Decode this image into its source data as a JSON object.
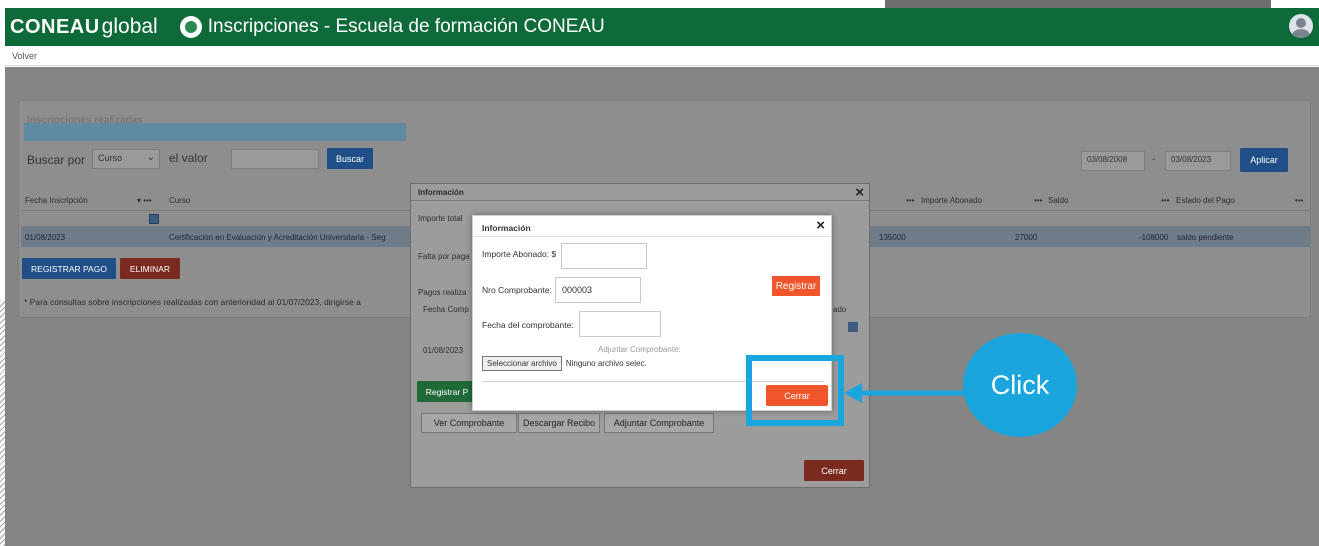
{
  "header": {
    "brand_bold": "CONEAU",
    "brand_light": "global",
    "app_title": "Inscripciones - Escuela de formación CONEAU",
    "icons": [
      "app-logo-icon",
      "user-avatar-icon"
    ]
  },
  "subbar": {
    "back_link": "Volver"
  },
  "panel": {
    "title": "Inscripciones realizadas",
    "search_label": "Buscar por",
    "search_field_value": "Curso",
    "value_label": "el valor",
    "search_button": "Buscar",
    "date_from": "03/08/2008",
    "date_sep": "-",
    "date_to": "03/08/2023",
    "apply_button": "Aplicar",
    "columns": [
      "Fecha Inscripción",
      "Curso",
      "Importe Abonado",
      "Saldo",
      "Estado del Pago"
    ],
    "row": {
      "fecha": "01/08/2023",
      "curso": "Certificación en Evaluación y Acreditación Universitaria - Seg",
      "importe_total": "135000",
      "importe_abonado": "27000",
      "saldo": "-108000",
      "estado": "saldo pendiente"
    },
    "register_payment_button": "REGISTRAR PAGO",
    "delete_button": "ELIMINAR",
    "note": "* Para consultas sobre inscripciones realizadas con anterioridad al 01/07/2023, dirigirse a"
  },
  "dialog_back": {
    "title": "Información",
    "importe_total_label": "Importe total",
    "falta_label": "Falta por paga",
    "pagos_label": "Pagos realiza",
    "col_fecha": "Fecha Comp",
    "col_estado": "ado",
    "row_fecha": "01/08/2023",
    "register_btn": "Registrar P",
    "ver_btn": "Ver Comprobante",
    "descargar_btn": "Descargar Recibo",
    "adjuntar_btn": "Adjuntar Comprobante",
    "close_btn": "Cerrar",
    "close_x": "×"
  },
  "dialog_front": {
    "title": "Información",
    "close_x": "×",
    "importe_label": "Importe Abonado: $",
    "importe_value": "",
    "nro_label": "Nro Comprobante:",
    "nro_value": "000003",
    "registrar_btn": "Registrar",
    "fecha_label": "Fecha del comprobante:",
    "fecha_value": "",
    "adjuntar_label": "Adjuntar Comprobante:",
    "file_button": "Seleccionar archivo",
    "file_status": "Ninguno archivo selec.",
    "close_btn": "Cerrar"
  },
  "annotation": {
    "click_label": "Click",
    "accent": "#1aa5dd"
  }
}
